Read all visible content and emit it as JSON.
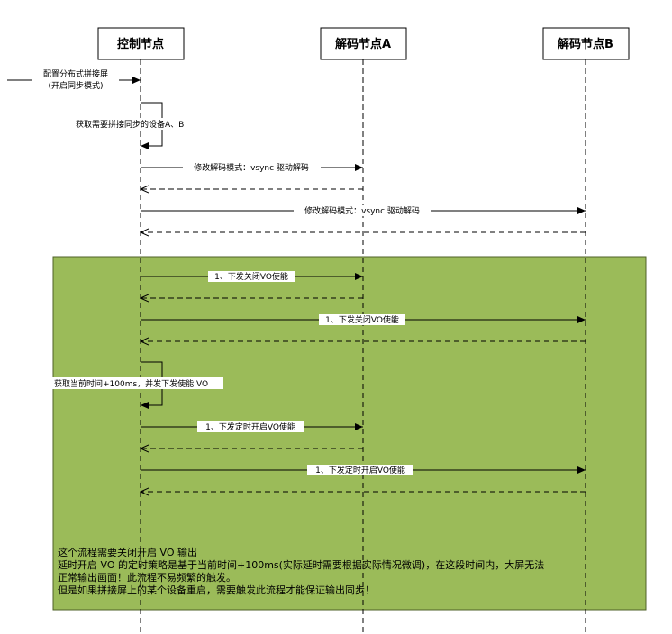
{
  "participants": {
    "control": "控制节点",
    "decoderA": "解码节点A",
    "decoderB": "解码节点B"
  },
  "messages": {
    "config_line1": "配置分布式拼接屏",
    "config_line2": "(开启同步模式)",
    "self_get_devices": "获取需要拼接同步的设备A、B",
    "modify_decode_A": "修改解码模式：vsync 驱动解码",
    "modify_decode_B": "修改解码模式：vsync 驱动解码",
    "disable_vo_A": "1、下发关闭VO使能",
    "disable_vo_B": "1、下发关闭VO使能",
    "self_get_time": "获取当前时间+100ms，并发下发使能 VO",
    "timed_enable_A": "1、下发定时开启VO使能",
    "timed_enable_B": "1、下发定时开启VO使能"
  },
  "note": {
    "line1": "这个流程需要关闭开启 VO 输出",
    "line2": "延时开启 VO 的定时策略是基于当前时间+100ms(实际延时需要根据实际情况微调)，在这段时间内，大屏无法",
    "line3": "正常输出画面！此流程不易频繁的触发。",
    "line4": "但是如果拼接屏上的某个设备重启，需要触发此流程才能保证输出同步！"
  },
  "colors": {
    "group_fill": "#9BBB59",
    "group_border": "#4F6228",
    "line": "#000000"
  }
}
